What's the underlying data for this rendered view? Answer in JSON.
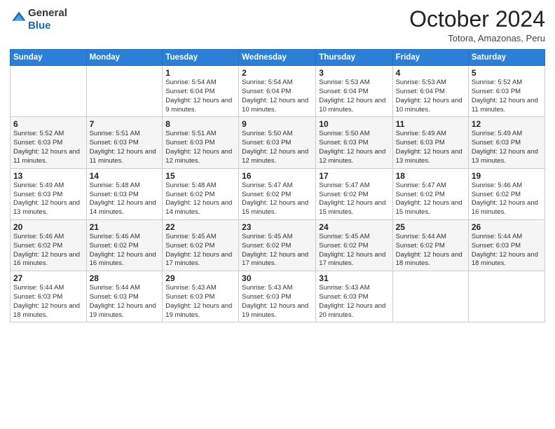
{
  "header": {
    "logo_line1": "General",
    "logo_line2": "Blue",
    "month": "October 2024",
    "location": "Totora, Amazonas, Peru"
  },
  "days_of_week": [
    "Sunday",
    "Monday",
    "Tuesday",
    "Wednesday",
    "Thursday",
    "Friday",
    "Saturday"
  ],
  "weeks": [
    [
      {
        "day": "",
        "info": ""
      },
      {
        "day": "",
        "info": ""
      },
      {
        "day": "1",
        "info": "Sunrise: 5:54 AM\nSunset: 6:04 PM\nDaylight: 12 hours and 9 minutes."
      },
      {
        "day": "2",
        "info": "Sunrise: 5:54 AM\nSunset: 6:04 PM\nDaylight: 12 hours and 10 minutes."
      },
      {
        "day": "3",
        "info": "Sunrise: 5:53 AM\nSunset: 6:04 PM\nDaylight: 12 hours and 10 minutes."
      },
      {
        "day": "4",
        "info": "Sunrise: 5:53 AM\nSunset: 6:04 PM\nDaylight: 12 hours and 10 minutes."
      },
      {
        "day": "5",
        "info": "Sunrise: 5:52 AM\nSunset: 6:03 PM\nDaylight: 12 hours and 11 minutes."
      }
    ],
    [
      {
        "day": "6",
        "info": "Sunrise: 5:52 AM\nSunset: 6:03 PM\nDaylight: 12 hours and 11 minutes."
      },
      {
        "day": "7",
        "info": "Sunrise: 5:51 AM\nSunset: 6:03 PM\nDaylight: 12 hours and 11 minutes."
      },
      {
        "day": "8",
        "info": "Sunrise: 5:51 AM\nSunset: 6:03 PM\nDaylight: 12 hours and 12 minutes."
      },
      {
        "day": "9",
        "info": "Sunrise: 5:50 AM\nSunset: 6:03 PM\nDaylight: 12 hours and 12 minutes."
      },
      {
        "day": "10",
        "info": "Sunrise: 5:50 AM\nSunset: 6:03 PM\nDaylight: 12 hours and 12 minutes."
      },
      {
        "day": "11",
        "info": "Sunrise: 5:49 AM\nSunset: 6:03 PM\nDaylight: 12 hours and 13 minutes."
      },
      {
        "day": "12",
        "info": "Sunrise: 5:49 AM\nSunset: 6:03 PM\nDaylight: 12 hours and 13 minutes."
      }
    ],
    [
      {
        "day": "13",
        "info": "Sunrise: 5:49 AM\nSunset: 6:03 PM\nDaylight: 12 hours and 13 minutes."
      },
      {
        "day": "14",
        "info": "Sunrise: 5:48 AM\nSunset: 6:03 PM\nDaylight: 12 hours and 14 minutes."
      },
      {
        "day": "15",
        "info": "Sunrise: 5:48 AM\nSunset: 6:02 PM\nDaylight: 12 hours and 14 minutes."
      },
      {
        "day": "16",
        "info": "Sunrise: 5:47 AM\nSunset: 6:02 PM\nDaylight: 12 hours and 15 minutes."
      },
      {
        "day": "17",
        "info": "Sunrise: 5:47 AM\nSunset: 6:02 PM\nDaylight: 12 hours and 15 minutes."
      },
      {
        "day": "18",
        "info": "Sunrise: 5:47 AM\nSunset: 6:02 PM\nDaylight: 12 hours and 15 minutes."
      },
      {
        "day": "19",
        "info": "Sunrise: 5:46 AM\nSunset: 6:02 PM\nDaylight: 12 hours and 16 minutes."
      }
    ],
    [
      {
        "day": "20",
        "info": "Sunrise: 5:46 AM\nSunset: 6:02 PM\nDaylight: 12 hours and 16 minutes."
      },
      {
        "day": "21",
        "info": "Sunrise: 5:46 AM\nSunset: 6:02 PM\nDaylight: 12 hours and 16 minutes."
      },
      {
        "day": "22",
        "info": "Sunrise: 5:45 AM\nSunset: 6:02 PM\nDaylight: 12 hours and 17 minutes."
      },
      {
        "day": "23",
        "info": "Sunrise: 5:45 AM\nSunset: 6:02 PM\nDaylight: 12 hours and 17 minutes."
      },
      {
        "day": "24",
        "info": "Sunrise: 5:45 AM\nSunset: 6:02 PM\nDaylight: 12 hours and 17 minutes."
      },
      {
        "day": "25",
        "info": "Sunrise: 5:44 AM\nSunset: 6:02 PM\nDaylight: 12 hours and 18 minutes."
      },
      {
        "day": "26",
        "info": "Sunrise: 5:44 AM\nSunset: 6:03 PM\nDaylight: 12 hours and 18 minutes."
      }
    ],
    [
      {
        "day": "27",
        "info": "Sunrise: 5:44 AM\nSunset: 6:03 PM\nDaylight: 12 hours and 18 minutes."
      },
      {
        "day": "28",
        "info": "Sunrise: 5:44 AM\nSunset: 6:03 PM\nDaylight: 12 hours and 19 minutes."
      },
      {
        "day": "29",
        "info": "Sunrise: 5:43 AM\nSunset: 6:03 PM\nDaylight: 12 hours and 19 minutes."
      },
      {
        "day": "30",
        "info": "Sunrise: 5:43 AM\nSunset: 6:03 PM\nDaylight: 12 hours and 19 minutes."
      },
      {
        "day": "31",
        "info": "Sunrise: 5:43 AM\nSunset: 6:03 PM\nDaylight: 12 hours and 20 minutes."
      },
      {
        "day": "",
        "info": ""
      },
      {
        "day": "",
        "info": ""
      }
    ]
  ]
}
